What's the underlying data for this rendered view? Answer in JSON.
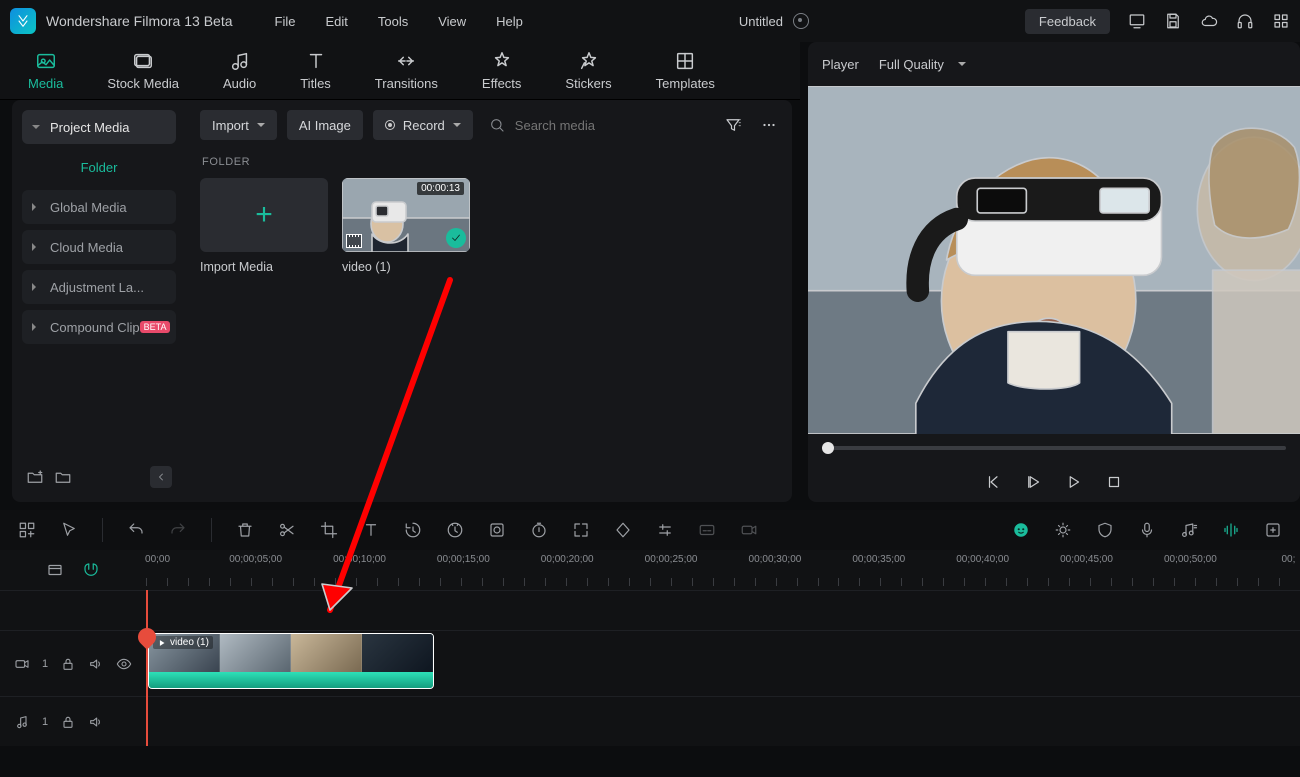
{
  "app": {
    "name": "Wondershare Filmora 13 Beta",
    "doc": "Untitled"
  },
  "menus": [
    "File",
    "Edit",
    "Tools",
    "View",
    "Help"
  ],
  "titlebar": {
    "feedback": "Feedback"
  },
  "tabs": [
    {
      "id": "media",
      "label": "Media",
      "active": true
    },
    {
      "id": "stock",
      "label": "Stock Media"
    },
    {
      "id": "audio",
      "label": "Audio"
    },
    {
      "id": "titles",
      "label": "Titles"
    },
    {
      "id": "transitions",
      "label": "Transitions"
    },
    {
      "id": "effects",
      "label": "Effects"
    },
    {
      "id": "stickers",
      "label": "Stickers"
    },
    {
      "id": "templates",
      "label": "Templates"
    }
  ],
  "sidebar": {
    "header": "Project Media",
    "folder": "Folder",
    "items": [
      "Global Media",
      "Cloud Media",
      "Adjustment La...",
      "Compound Clip"
    ],
    "beta": "BETA"
  },
  "media": {
    "import": "Import",
    "ai": "AI Image",
    "record": "Record",
    "search_ph": "Search media",
    "folder_label": "FOLDER",
    "import_media": "Import Media",
    "clip": {
      "name": "video (1)",
      "duration": "00:00:13"
    }
  },
  "player": {
    "label": "Player",
    "quality": "Full Quality"
  },
  "timeline": {
    "ticks": [
      "00;00",
      "00;00;05;00",
      "00;00;10;00",
      "00;00;15;00",
      "00;00;20;00",
      "00;00;25;00",
      "00;00;30;00",
      "00;00;35;00",
      "00;00;40;00",
      "00;00;45;00",
      "00;00;50;00",
      "00;"
    ],
    "video_track": "1",
    "audio_track": "1",
    "clip_label": "video (1)"
  }
}
